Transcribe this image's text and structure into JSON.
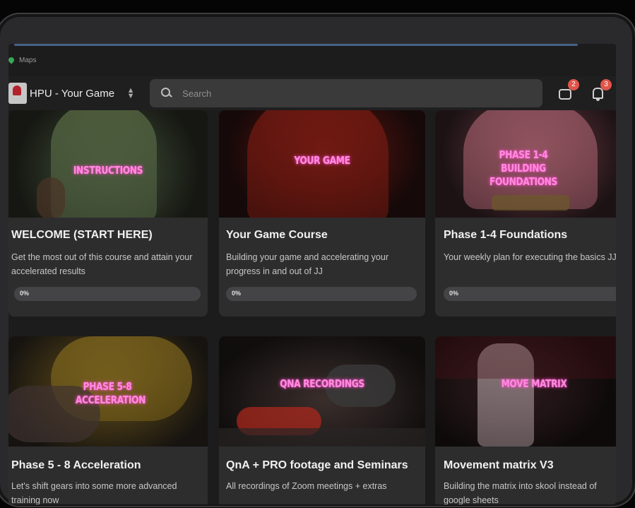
{
  "os": {
    "back_app_label": "Maps"
  },
  "header": {
    "group_name": "HPU - Your Game",
    "search_placeholder": "Search",
    "chat_badge": "2",
    "notification_badge": "3"
  },
  "courses": [
    {
      "thumb_text": "INSTRUCTIONS",
      "title": "WELCOME (START HERE)",
      "description": "Get the most out of this course and attain your accelerated results",
      "progress_label": "0%",
      "progress": 0
    },
    {
      "thumb_text": "YOUR GAME",
      "title": "Your Game Course",
      "description": "Building your game and accelerating your progress in and out of JJ",
      "progress_label": "0%",
      "progress": 0
    },
    {
      "thumb_text": "PHASE 1-4 BUILDING FOUNDATIONS",
      "title": "Phase 1-4 Foundations",
      "description": "Your weekly plan for executing the basics JJ",
      "progress_label": "0%",
      "progress": 0
    },
    {
      "thumb_text": "PHASE 5-8 ACCELERATION",
      "title": "Phase 5 - 8 Acceleration",
      "description": "Let's shift gears into some more advanced training now"
    },
    {
      "thumb_text": "QNA RECORDINGS",
      "title": "QnA + PRO footage and Seminars",
      "description": "All recordings of Zoom meetings + extras"
    },
    {
      "thumb_text": "MOVE MATRIX",
      "title": "Movement matrix V3",
      "description": "Building the matrix into skool instead of google sheets"
    }
  ],
  "colors": {
    "background": "#1c1c1d",
    "card": "#2d2d2e",
    "badge": "#e2554a",
    "neon_pink": "#ff8be0"
  }
}
